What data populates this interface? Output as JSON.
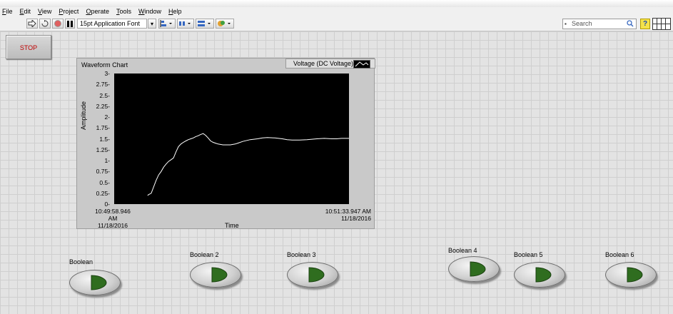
{
  "menu": [
    {
      "pre": "",
      "u": "F",
      "post": "ile"
    },
    {
      "pre": "",
      "u": "E",
      "post": "dit"
    },
    {
      "pre": "",
      "u": "V",
      "post": "iew"
    },
    {
      "pre": "",
      "u": "P",
      "post": "roject"
    },
    {
      "pre": "",
      "u": "O",
      "post": "perate"
    },
    {
      "pre": "",
      "u": "T",
      "post": "ools"
    },
    {
      "pre": "",
      "u": "W",
      "post": "indow"
    },
    {
      "pre": "",
      "u": "H",
      "post": "elp"
    }
  ],
  "toolbar": {
    "font_label": "15pt Application Font",
    "search_placeholder": "Search",
    "help_glyph": "?"
  },
  "stop": {
    "label": "STOP",
    "color": "#c00000"
  },
  "chart": {
    "title": "Waveform Chart",
    "legend_label": "Voltage (DC Voltage)",
    "x_axis_label": "Time",
    "y_axis_label": "Amplitude",
    "x_start_time": "10:49:58.946 AM",
    "x_start_date": "11/18/2016",
    "x_end_time": "10:51:33.947 AM",
    "x_end_date": "11/18/2016",
    "y_ticks": [
      "3",
      "2.75",
      "2.5",
      "2.25",
      "2",
      "1.75",
      "1.5",
      "1.25",
      "1",
      "0.75",
      "0.5",
      "0.25",
      "0"
    ]
  },
  "chart_data": {
    "type": "line",
    "title": "Waveform Chart",
    "xlabel": "Time",
    "ylabel": "Amplitude",
    "ylim": [
      0,
      3
    ],
    "xlim": [
      "10:49:58.946 AM",
      "10:51:33.947 AM"
    ],
    "grid": false,
    "legend": "top-right",
    "series": [
      {
        "name": "Voltage (DC Voltage)",
        "color": "#ffffff",
        "x_seconds_elapsed": [
          13.5,
          14,
          15,
          16,
          17,
          18,
          19,
          20,
          21,
          22,
          23,
          24,
          25,
          26,
          27,
          28,
          29,
          30,
          31,
          32,
          33,
          34,
          35,
          36,
          37,
          38,
          39,
          40,
          41,
          42,
          43,
          44,
          45,
          46,
          47,
          48,
          49,
          50,
          52,
          55,
          58,
          60,
          62,
          65,
          68,
          70,
          72,
          75,
          78,
          80,
          82,
          85,
          88,
          90,
          92,
          95
        ],
        "values": [
          0.2,
          0.22,
          0.25,
          0.4,
          0.55,
          0.67,
          0.75,
          0.85,
          0.92,
          0.98,
          1.02,
          1.06,
          1.2,
          1.32,
          1.38,
          1.42,
          1.45,
          1.48,
          1.5,
          1.52,
          1.55,
          1.57,
          1.6,
          1.62,
          1.58,
          1.52,
          1.45,
          1.42,
          1.4,
          1.38,
          1.37,
          1.36,
          1.36,
          1.36,
          1.36,
          1.37,
          1.38,
          1.4,
          1.44,
          1.48,
          1.5,
          1.52,
          1.53,
          1.52,
          1.5,
          1.48,
          1.47,
          1.47,
          1.48,
          1.49,
          1.5,
          1.51,
          1.5,
          1.5,
          1.51,
          1.51
        ]
      }
    ]
  },
  "booleans": [
    {
      "label": "Boolean",
      "led_color": "#2f6d1f"
    },
    {
      "label": "Boolean 2",
      "led_color": "#2f6d1f"
    },
    {
      "label": "Boolean 3",
      "led_color": "#2f6d1f"
    },
    {
      "label": "Boolean 4",
      "led_color": "#2f6d1f"
    },
    {
      "label": "Boolean 5",
      "led_color": "#2f6d1f"
    },
    {
      "label": "Boolean 6",
      "led_color": "#2f6d1f"
    }
  ],
  "icons": {
    "run": "run-arrow-icon",
    "run_continuous": "run-continuous-icon",
    "abort": "abort-icon",
    "pause": "pause-icon",
    "align": "align-objects-icon",
    "distribute": "distribute-objects-icon",
    "resize": "resize-objects-icon",
    "reorder": "reorder-icon",
    "search": "magnifier-icon",
    "help": "context-help-icon"
  }
}
